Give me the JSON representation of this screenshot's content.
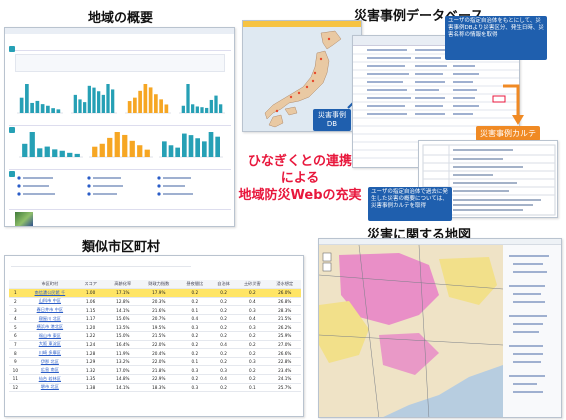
{
  "titles": {
    "overview": "地域の概要",
    "disaster_db": "災害事例データベース",
    "similar": "類似市区町村",
    "map": "災害に関する地図"
  },
  "center": {
    "line1": "ひなぎくとの連携",
    "line2": "による",
    "line3": "地域防災Webの充実"
  },
  "callouts": {
    "db_label": "災害事例\nDB",
    "top_note": "ユーザの指定自治体をもとにして、災害事例DBより災害区分、発生日時、災害名称の情報を取得",
    "karte_label": "災害事例カルテ",
    "bottom_note": "ユーザの指定自治体で過去に発生した災害の概要については、災害事例カルテを取得"
  },
  "similar_table": {
    "headers": [
      "",
      "市区町村",
      "スコア",
      "",
      "高齢化率",
      "財政力指数",
      "昼夜間比",
      "自治体",
      "土砂災害",
      "浸水想定"
    ],
    "rows": [
      [
        "1",
        "南信濃公民館 千",
        "1.00",
        "",
        "17.1%",
        "17.9%",
        "0.2",
        "0.2",
        "0.2",
        "26.0%"
      ],
      [
        "2",
        "山科市 中区",
        "1.06",
        "",
        "12.8%",
        "20.3%",
        "0.2",
        "0.2",
        "0.4",
        "26.8%"
      ],
      [
        "3",
        "春日井市 中区",
        "1.15",
        "",
        "14.1%",
        "21.6%",
        "0.1",
        "0.2",
        "0.3",
        "28.3%"
      ],
      [
        "4",
        "寝屋川 北区",
        "1.17",
        "",
        "15.6%",
        "20.7%",
        "0.4",
        "0.2",
        "0.4",
        "21.5%"
      ],
      [
        "5",
        "横浜市 港北区",
        "1.20",
        "",
        "13.5%",
        "19.5%",
        "0.3",
        "0.2",
        "0.3",
        "26.2%"
      ],
      [
        "6",
        "福山市 東区",
        "1.22",
        "",
        "15.0%",
        "21.5%",
        "0.2",
        "0.2",
        "0.2",
        "25.9%"
      ],
      [
        "7",
        "大阪 東淀区",
        "1.24",
        "",
        "16.4%",
        "22.0%",
        "0.2",
        "0.4",
        "0.2",
        "27.0%"
      ],
      [
        "8",
        "川崎 多摩区",
        "1.28",
        "",
        "11.9%",
        "20.4%",
        "0.2",
        "0.2",
        "0.2",
        "26.6%"
      ],
      [
        "9",
        "伊那 北区",
        "1.29",
        "",
        "13.2%",
        "22.0%",
        "0.1",
        "0.2",
        "0.3",
        "22.8%"
      ],
      [
        "10",
        "広島 南区",
        "1.32",
        "",
        "17.0%",
        "21.8%",
        "0.3",
        "0.3",
        "0.2",
        "23.4%"
      ],
      [
        "11",
        "仙台 若林区",
        "1.35",
        "",
        "14.8%",
        "22.9%",
        "0.2",
        "0.4",
        "0.2",
        "24.1%"
      ],
      [
        "12",
        "堺市 北区",
        "1.38",
        "",
        "14.1%",
        "18.3%",
        "0.3",
        "0.2",
        "0.1",
        "25.7%"
      ]
    ]
  },
  "overview_charts": {
    "chart1": [
      38,
      72,
      25,
      30,
      22,
      18,
      12,
      9
    ],
    "chart2": [
      20,
      15,
      12,
      30,
      28,
      24,
      20,
      32,
      26
    ],
    "chart3": [
      14,
      18,
      26,
      34,
      30,
      22,
      16,
      10
    ],
    "chart4": [
      10,
      40,
      12,
      9,
      8,
      7,
      18,
      24,
      12
    ]
  },
  "colors": {
    "teal": "#26a0b5",
    "orange": "#f6a623",
    "blue_callout": "#1f5fae",
    "red_text": "#e8173c",
    "pink_map": "#e780c7",
    "yellow_map": "#f2e08a"
  }
}
